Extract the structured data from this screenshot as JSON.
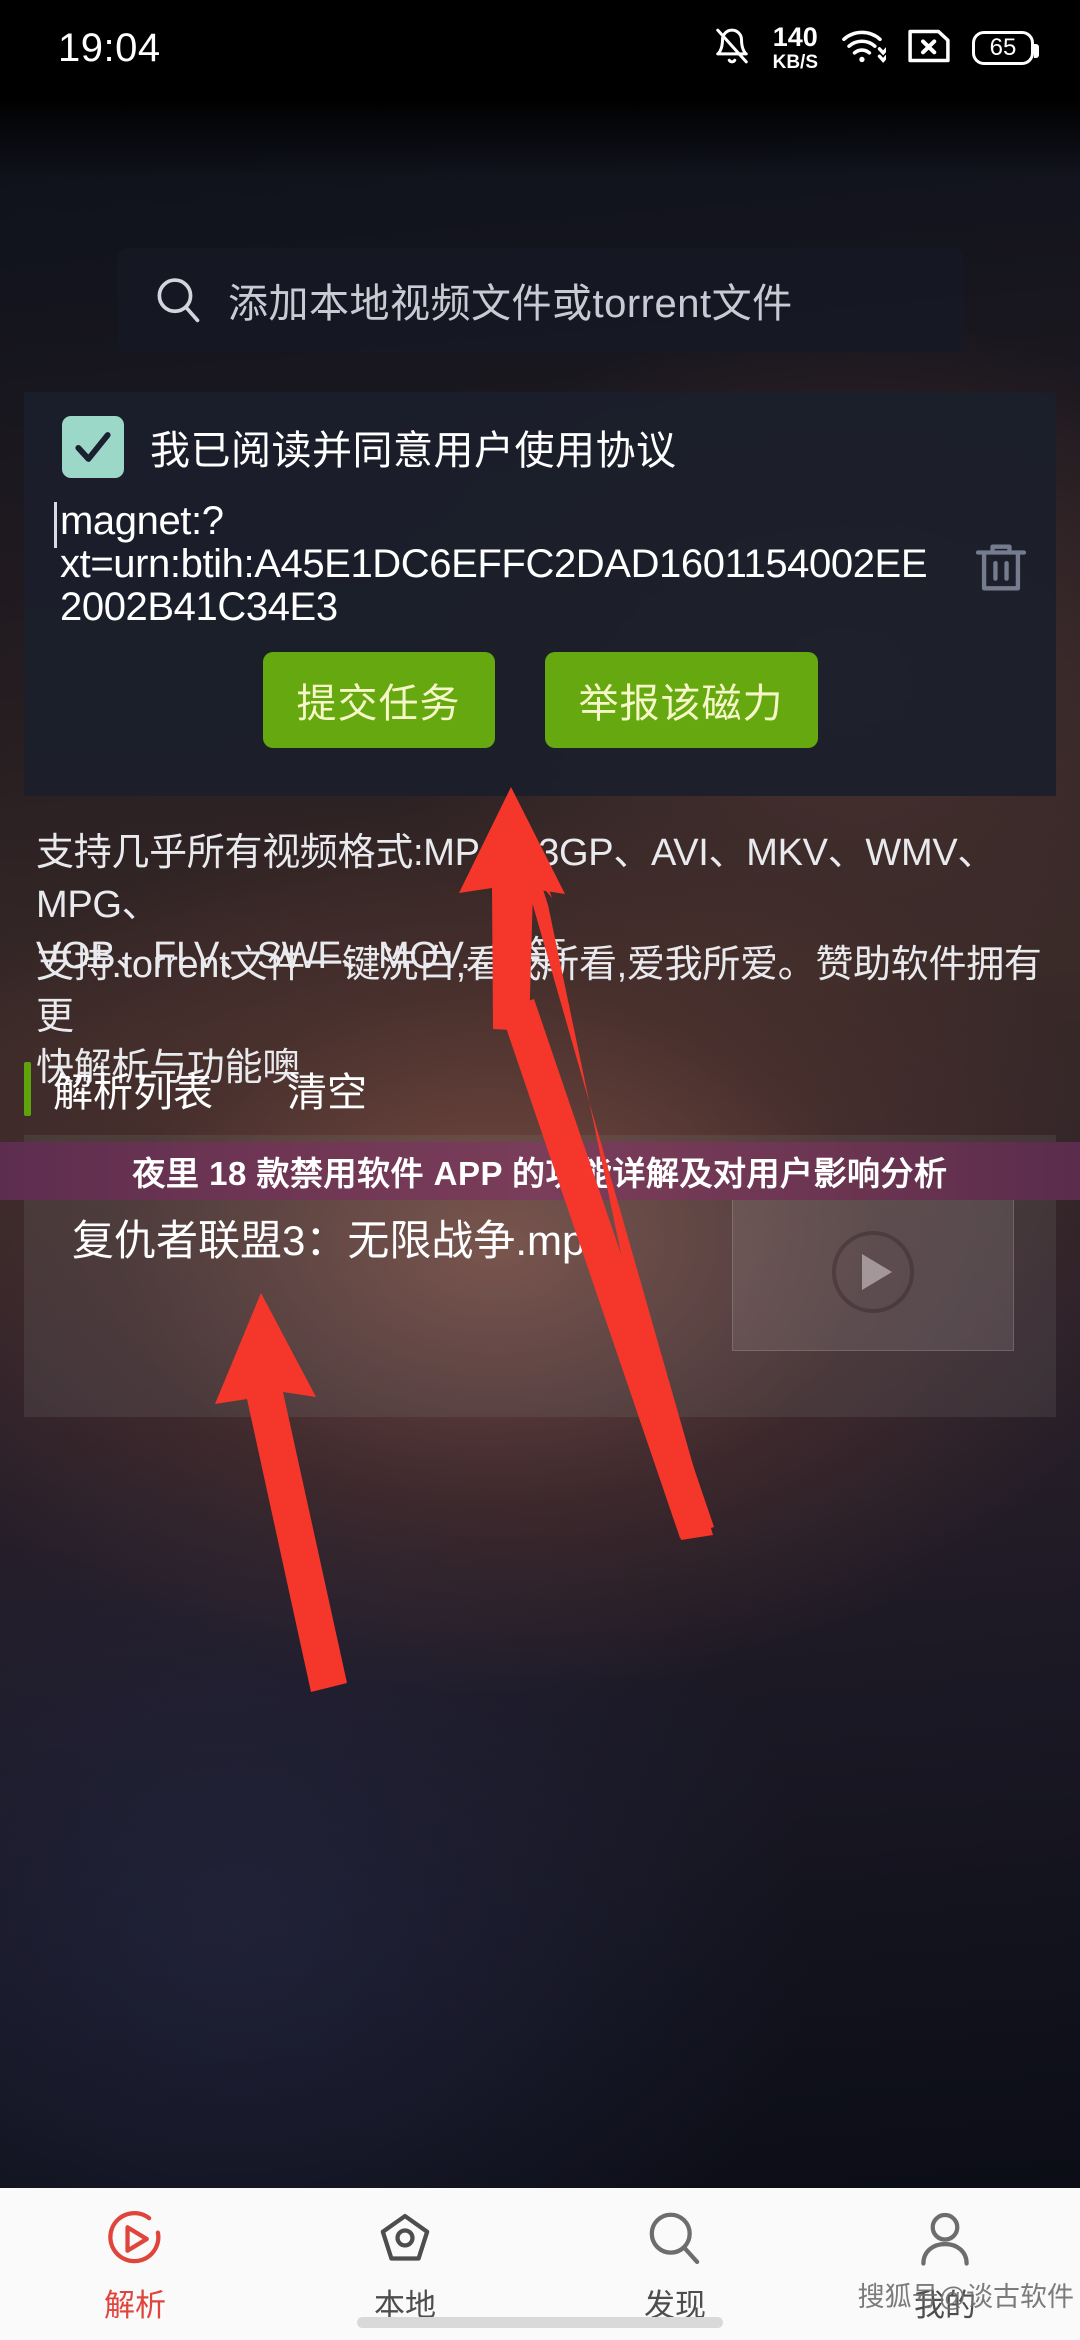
{
  "statusbar": {
    "time": "19:04",
    "net_speed_value": "140",
    "net_speed_unit": "KB/S",
    "battery_level": "65",
    "icons": [
      "bell-muted-icon",
      "network-speed",
      "wifi-icon",
      "sim-no-signal-icon",
      "battery-icon"
    ]
  },
  "search": {
    "placeholder": "添加本地视频文件或torrent文件",
    "icon": "search-icon"
  },
  "panel": {
    "agreement_label": "我已阅读并同意用户使用协议",
    "agreement_checked": true,
    "magnet_value": "magnet:?xt=urn:btih:A45E1DC6EFFC2DAD1601154002EE2002B41C34E3",
    "magnet_line1": "magnet:?",
    "magnet_line2": "xt=urn:btih:A45E1DC6EFFC2DAD1601154002EE",
    "magnet_line3": "2002B41C34E3",
    "delete_icon": "trash-icon",
    "submit_label": "提交任务",
    "report_label": "举报该磁力",
    "button_color": "#66a80f",
    "button_text_color": "#f6f7c9",
    "checkbox_color": "#9bd8c8"
  },
  "info": {
    "formats_line1": "支持几乎所有视频格式:MP4、3GP、AVI、MKV、WMV、MPG、",
    "formats_line2": "VOB、FLV、SWF、MOV...等等",
    "torrent_line1": "支持.torrent文件一键洗白,看我所看,爱我所爱。赞助软件拥有更",
    "torrent_line2": "快解析与功能噢"
  },
  "list": {
    "header_label": "解析列表",
    "clear_label": "清空",
    "accent_color": "#5fa30c",
    "items": [
      {
        "title": "复仇者联盟3：无限战争.mp4",
        "thumb_icon": "play-icon"
      }
    ]
  },
  "banner": {
    "text": "夜里 18 款禁用软件 APP 的功能详解及对用户影响分析",
    "background_color": "#6d3553"
  },
  "annotations": {
    "arrow_color": "#f5372b",
    "arrows": [
      {
        "name": "arrow-to-submit-button",
        "points_at": "提交任务"
      },
      {
        "name": "arrow-to-result-item",
        "points_at": "复仇者联盟3：无限战争.mp4"
      }
    ]
  },
  "bottomnav": {
    "active_color": "#e0453c",
    "items": [
      {
        "label": "解析",
        "icon": "parse-play-icon",
        "active": true
      },
      {
        "label": "本地",
        "icon": "local-eye-icon",
        "active": false
      },
      {
        "label": "发现",
        "icon": "discover-search-icon",
        "active": false
      },
      {
        "label": "我的",
        "icon": "profile-person-icon",
        "active": false
      }
    ]
  },
  "watermark": {
    "text": "搜狐号@谈古软件"
  }
}
